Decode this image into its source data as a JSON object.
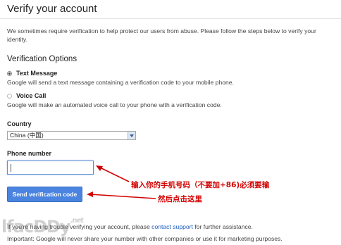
{
  "page": {
    "title": "Verify your account",
    "intro": "We sometimes require verification to help protect our users from abuse. Please follow the steps below to verify your identity."
  },
  "verification": {
    "section_title": "Verification Options",
    "options": [
      {
        "label": "Text Message",
        "description": "Google will send a text message containing a verification code to your mobile phone.",
        "selected": true
      },
      {
        "label": "Voice Call",
        "description": "Google will make an automated voice call to your phone with a verification code.",
        "selected": false
      }
    ]
  },
  "country": {
    "label": "Country",
    "selected": "China (中国)"
  },
  "phone": {
    "label": "Phone number",
    "value": ""
  },
  "send_button": {
    "label": "Send verification code"
  },
  "footer": {
    "trouble_prefix": "If you're having trouble verifying your account, please",
    "contact_link": "contact support",
    "trouble_suffix": "for further assistance.",
    "important": "Important: Google will never share your number with other companies or use it for marketing purposes."
  },
  "annotations": {
    "phone_hint": "输入你的手机号码（不要加+86)必须要输",
    "button_hint": "然后点击这里",
    "color": "#d20000"
  },
  "watermark": {
    "text": "lfacDDy",
    "suffix": ".net"
  },
  "colors": {
    "button": "#4a84e0",
    "link": "#1f5fbf",
    "input_focus": "#5c8fd6"
  }
}
